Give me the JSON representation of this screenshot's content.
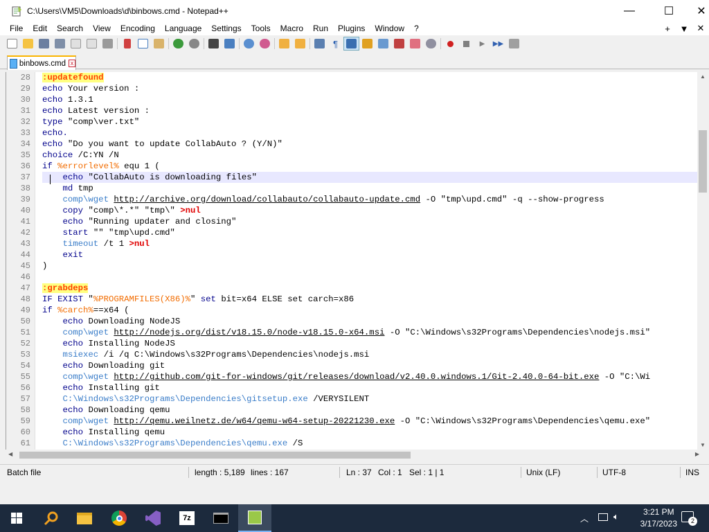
{
  "window": {
    "title": "C:\\Users\\VM5\\Downloads\\d\\binbows.cmd - Notepad++",
    "minimize": "—",
    "maximize": "☐",
    "close": "✕"
  },
  "menu": {
    "items": [
      "File",
      "Edit",
      "Search",
      "View",
      "Encoding",
      "Language",
      "Settings",
      "Tools",
      "Macro",
      "Run",
      "Plugins",
      "Window",
      "?"
    ],
    "right": [
      "+",
      "▼",
      "✕"
    ]
  },
  "tab": {
    "label": "binbows.cmd",
    "close": "x"
  },
  "editor": {
    "lines": [
      {
        "n": "28",
        "parts": [
          [
            "lab",
            ":updatefound"
          ]
        ]
      },
      {
        "n": "29",
        "parts": [
          [
            "kw",
            "echo"
          ],
          [
            "t",
            " Your version :"
          ]
        ]
      },
      {
        "n": "30",
        "parts": [
          [
            "kw",
            "echo"
          ],
          [
            "t",
            " 1.3.1"
          ]
        ]
      },
      {
        "n": "31",
        "parts": [
          [
            "kw",
            "echo"
          ],
          [
            "t",
            " Latest version :"
          ]
        ]
      },
      {
        "n": "32",
        "parts": [
          [
            "kw",
            "type"
          ],
          [
            "t",
            " \"comp\\ver.txt\""
          ]
        ]
      },
      {
        "n": "33",
        "parts": [
          [
            "kw",
            "echo."
          ]
        ]
      },
      {
        "n": "34",
        "parts": [
          [
            "kw",
            "echo"
          ],
          [
            "t",
            " \"Do you want to update CollabAuto ? (Y/N)\""
          ]
        ]
      },
      {
        "n": "35",
        "parts": [
          [
            "kw",
            "choice"
          ],
          [
            "t",
            " /C:YN /N"
          ]
        ]
      },
      {
        "n": "36",
        "parts": [
          [
            "kw",
            "if"
          ],
          [
            "t",
            " "
          ],
          [
            "var",
            "%errorlevel%"
          ],
          [
            "t",
            " equ 1 ("
          ]
        ]
      },
      {
        "n": "37",
        "cur": true,
        "parts": [
          [
            "t",
            "    "
          ],
          [
            "kw",
            "echo"
          ],
          [
            "t",
            " \"CollabAuto is downloading files\""
          ]
        ]
      },
      {
        "n": "38",
        "parts": [
          [
            "t",
            "    "
          ],
          [
            "kw",
            "md"
          ],
          [
            "t",
            " tmp"
          ]
        ]
      },
      {
        "n": "39",
        "parts": [
          [
            "t",
            "    "
          ],
          [
            "ext",
            "comp\\wget"
          ],
          [
            "t",
            " "
          ],
          [
            "url",
            "http://archive.org/download/collabauto/collabauto-update.cmd"
          ],
          [
            "t",
            " -O \"tmp\\upd.cmd\" -q --show-progress"
          ]
        ]
      },
      {
        "n": "40",
        "parts": [
          [
            "t",
            "    "
          ],
          [
            "kw",
            "copy"
          ],
          [
            "t",
            " \"comp\\*.*\" \"tmp\\\" "
          ],
          [
            "red",
            ">nul"
          ]
        ]
      },
      {
        "n": "41",
        "parts": [
          [
            "t",
            "    "
          ],
          [
            "kw",
            "echo"
          ],
          [
            "t",
            " \"Running updater and closing\""
          ]
        ]
      },
      {
        "n": "42",
        "parts": [
          [
            "t",
            "    "
          ],
          [
            "kw",
            "start"
          ],
          [
            "t",
            " \"\" \"tmp\\upd.cmd\""
          ]
        ]
      },
      {
        "n": "43",
        "parts": [
          [
            "t",
            "    "
          ],
          [
            "ext",
            "timeout"
          ],
          [
            "t",
            " /t 1 "
          ],
          [
            "red",
            ">nul"
          ]
        ]
      },
      {
        "n": "44",
        "parts": [
          [
            "t",
            "    "
          ],
          [
            "kw",
            "exit"
          ]
        ]
      },
      {
        "n": "45",
        "parts": [
          [
            "t",
            ")"
          ]
        ]
      },
      {
        "n": "46",
        "parts": []
      },
      {
        "n": "47",
        "parts": [
          [
            "lab",
            ":grabdeps"
          ]
        ]
      },
      {
        "n": "48",
        "parts": [
          [
            "kw",
            "IF EXIST"
          ],
          [
            "t",
            " \""
          ],
          [
            "var",
            "%PROGRAMFILES(X86)%"
          ],
          [
            "t",
            "\" "
          ],
          [
            "kw",
            "set"
          ],
          [
            "t",
            " bit=x64 ELSE set carch=x86"
          ]
        ]
      },
      {
        "n": "49",
        "parts": [
          [
            "kw",
            "if"
          ],
          [
            "t",
            " "
          ],
          [
            "var",
            "%carch%"
          ],
          [
            "t",
            "==x64 ("
          ]
        ]
      },
      {
        "n": "50",
        "parts": [
          [
            "t",
            "    "
          ],
          [
            "kw",
            "echo"
          ],
          [
            "t",
            " Downloading NodeJS"
          ]
        ]
      },
      {
        "n": "51",
        "parts": [
          [
            "t",
            "    "
          ],
          [
            "ext",
            "comp\\wget"
          ],
          [
            "t",
            " "
          ],
          [
            "url",
            "http://nodejs.org/dist/v18.15.0/node-v18.15.0-x64.msi"
          ],
          [
            "t",
            " -O \"C:\\Windows\\s32Programs\\Dependencies\\nodejs.msi\""
          ]
        ]
      },
      {
        "n": "52",
        "parts": [
          [
            "t",
            "    "
          ],
          [
            "kw",
            "echo"
          ],
          [
            "t",
            " Installing NodeJS"
          ]
        ]
      },
      {
        "n": "53",
        "parts": [
          [
            "t",
            "    "
          ],
          [
            "ext",
            "msiexec"
          ],
          [
            "t",
            " /i /q C:\\Windows\\s32Programs\\Dependencies\\nodejs.msi"
          ]
        ]
      },
      {
        "n": "54",
        "parts": [
          [
            "t",
            "    "
          ],
          [
            "kw",
            "echo"
          ],
          [
            "t",
            " Downloading git"
          ]
        ]
      },
      {
        "n": "55",
        "parts": [
          [
            "t",
            "    "
          ],
          [
            "ext",
            "comp\\wget"
          ],
          [
            "t",
            " "
          ],
          [
            "url",
            "http://github.com/git-for-windows/git/releases/download/v2.40.0.windows.1/Git-2.40.0-64-bit.exe"
          ],
          [
            "t",
            " -O \"C:\\Wi"
          ]
        ]
      },
      {
        "n": "56",
        "parts": [
          [
            "t",
            "    "
          ],
          [
            "kw",
            "echo"
          ],
          [
            "t",
            " Installing git"
          ]
        ]
      },
      {
        "n": "57",
        "parts": [
          [
            "t",
            "    "
          ],
          [
            "ext",
            "C:\\Windows\\s32Programs\\Dependencies\\gitsetup.exe"
          ],
          [
            "t",
            " /VERYSILENT"
          ]
        ]
      },
      {
        "n": "58",
        "parts": [
          [
            "t",
            "    "
          ],
          [
            "kw",
            "echo"
          ],
          [
            "t",
            " Downloading qemu"
          ]
        ]
      },
      {
        "n": "59",
        "parts": [
          [
            "t",
            "    "
          ],
          [
            "ext",
            "comp\\wget"
          ],
          [
            "t",
            " "
          ],
          [
            "url",
            "http://qemu.weilnetz.de/w64/qemu-w64-setup-20221230.exe"
          ],
          [
            "t",
            " -O \"C:\\Windows\\s32Programs\\Dependencies\\qemu.exe\""
          ]
        ]
      },
      {
        "n": "60",
        "parts": [
          [
            "t",
            "    "
          ],
          [
            "kw",
            "echo"
          ],
          [
            "t",
            " Installing qemu"
          ]
        ]
      },
      {
        "n": "61",
        "parts": [
          [
            "t",
            "    "
          ],
          [
            "ext",
            "C:\\Windows\\s32Programs\\Dependencies\\qemu.exe"
          ],
          [
            "t",
            " /S"
          ]
        ]
      }
    ]
  },
  "status": {
    "type": "Batch file",
    "length": "length : 5,189",
    "lines": "lines : 167",
    "ln": "Ln : 37",
    "col": "Col : 1",
    "sel": "Sel : 1 | 1",
    "eol": "Unix (LF)",
    "encoding": "UTF-8",
    "mode": "INS"
  },
  "taskbar": {
    "time": "3:21 PM",
    "date": "3/17/2023",
    "notif_count": "2"
  },
  "colors": {
    "keyword": "#00008b",
    "variable": "#f26c00",
    "label_bg": "#ffff80",
    "taskbar": "#1c2a3d"
  }
}
